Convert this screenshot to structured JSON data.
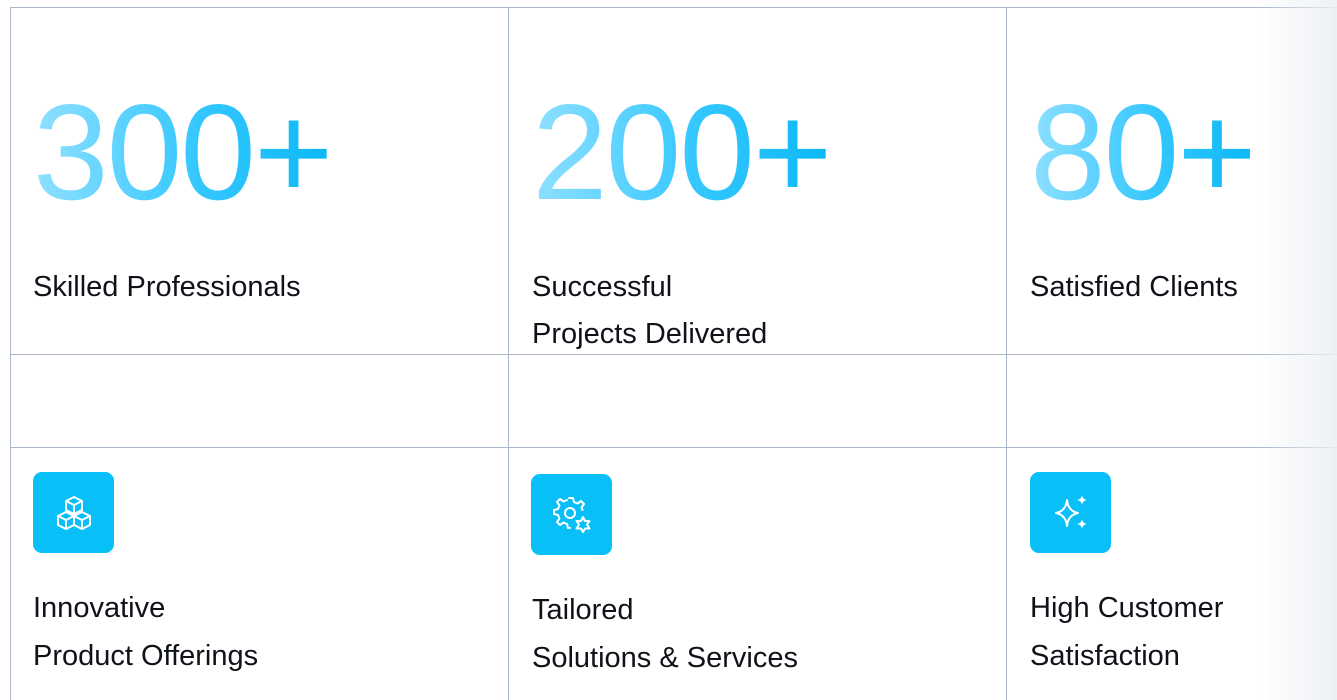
{
  "stats": [
    {
      "number": "300+",
      "label_lines": [
        "Skilled Professionals"
      ]
    },
    {
      "number": "200+",
      "label_lines": [
        "Successful",
        "Projects Delivered"
      ]
    },
    {
      "number": "80+",
      "label_lines": [
        "Satisfied Clients"
      ]
    }
  ],
  "features": [
    {
      "icon": "cubes-icon",
      "label_lines": [
        "Innovative",
        "Product Offerings"
      ]
    },
    {
      "icon": "gear-settings-icon",
      "label_lines": [
        "Tailored",
        "Solutions & Services"
      ]
    },
    {
      "icon": "sparkles-icon",
      "label_lines": [
        "High Customer",
        "Satisfaction"
      ]
    }
  ],
  "colors": {
    "accent": "#08bff7",
    "number_gradient_start": "#8fe0ff",
    "number_gradient_end": "#0cb8f5",
    "grid_line": "#a9b7c9",
    "text": "#0f1219"
  }
}
